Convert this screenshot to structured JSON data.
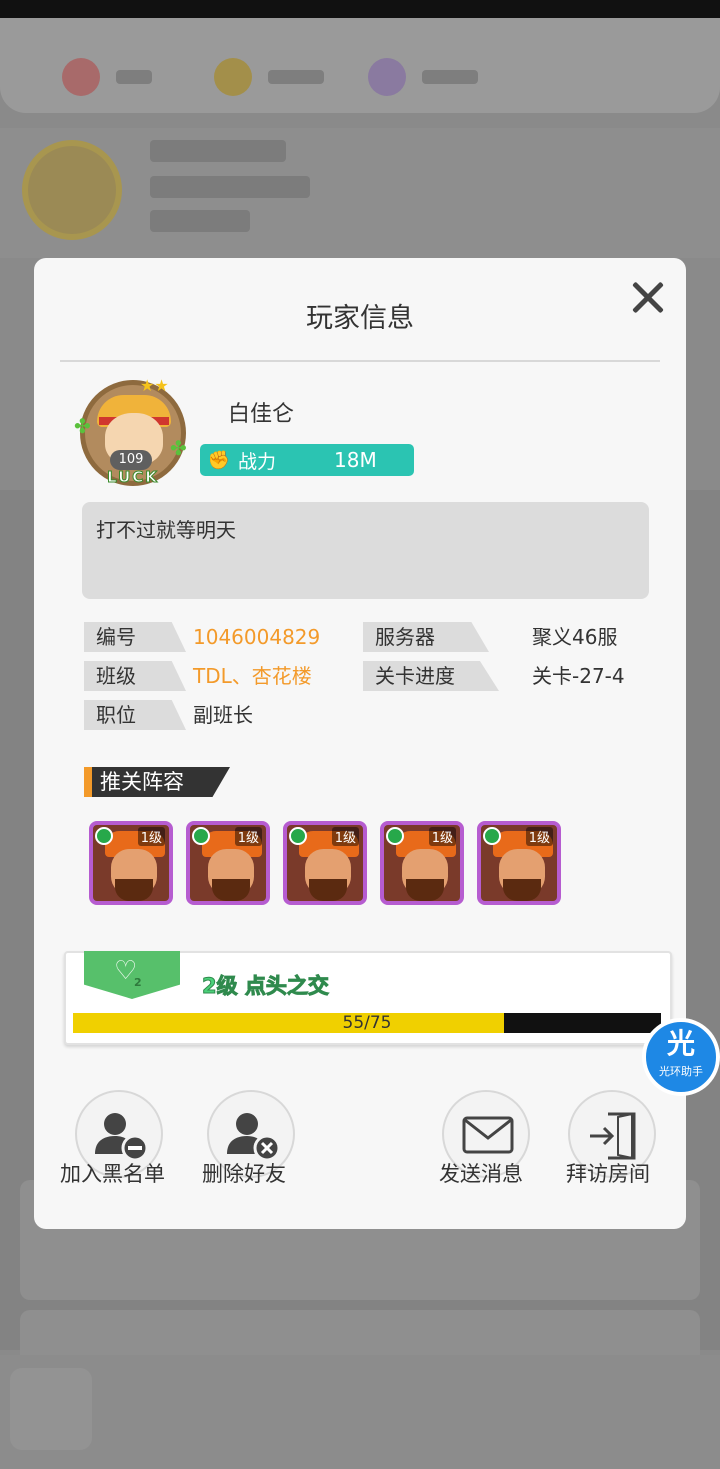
{
  "dialog": {
    "title": "玩家信息",
    "close_icon": "close-icon"
  },
  "player": {
    "name": "白佳仑",
    "avatar_level": "109",
    "avatar_text": "LUCK",
    "power_label": "战力",
    "power_value": "18M",
    "signature": "打不过就等明天"
  },
  "info": {
    "id_label": "编号",
    "id_value": "1046004829",
    "server_label": "服务器",
    "server_value": "聚义46服",
    "class_label": "班级",
    "class_value": "TDL、杏花楼",
    "stage_label": "关卡进度",
    "stage_value": "关卡-27-4",
    "position_label": "职位",
    "position_value": "副班长"
  },
  "lineup": {
    "title": "推关阵容",
    "heroes": [
      {
        "level": "1级"
      },
      {
        "level": "1级"
      },
      {
        "level": "1级"
      },
      {
        "level": "1级"
      },
      {
        "level": "1级"
      }
    ]
  },
  "friendship": {
    "heart_level": "2",
    "level_text": "2级 点头之交",
    "progress_text": "55/75",
    "progress_fraction": 0.7333
  },
  "helper": {
    "glyph": "光",
    "label": "光环助手"
  },
  "actions": {
    "blacklist": "加入黑名单",
    "delete_friend": "删除好友",
    "send_message": "发送消息",
    "visit_room": "拜访房间"
  },
  "colors": {
    "accent_teal": "#2bc4b2",
    "accent_orange": "#f39a2a",
    "progress_yellow": "#f0d000",
    "friend_green": "#57c06b"
  }
}
